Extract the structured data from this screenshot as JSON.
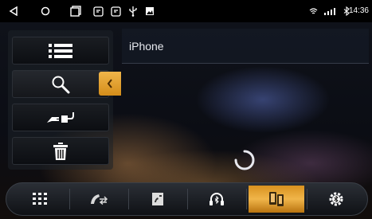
{
  "status_bar": {
    "time": "14:36",
    "icons": [
      "back-triangle-icon",
      "home-circle-icon",
      "recents-square-icon",
      "media-icon",
      "media-icon",
      "usb-icon",
      "image-icon",
      "wifi-icon",
      "cell-signal-icon",
      "bluetooth-icon"
    ]
  },
  "menu": {
    "items": [
      {
        "icon": "list-icon"
      },
      {
        "icon": "search-icon"
      },
      {
        "icon": "connect-plug-icon"
      },
      {
        "icon": "trash-icon"
      }
    ],
    "collapse_icon": "chevron-left-icon"
  },
  "device": {
    "name": "iPhone"
  },
  "dock": {
    "items": [
      {
        "icon": "dialpad-icon"
      },
      {
        "icon": "call-transfer-icon"
      },
      {
        "icon": "contacts-book-icon"
      },
      {
        "icon": "bluetooth-music-icon"
      },
      {
        "icon": "phone-link-icon",
        "selected": true
      },
      {
        "icon": "bluetooth-settings-icon"
      }
    ]
  },
  "colors": {
    "accent": "#e9a53a",
    "status_bar": "#000000"
  }
}
